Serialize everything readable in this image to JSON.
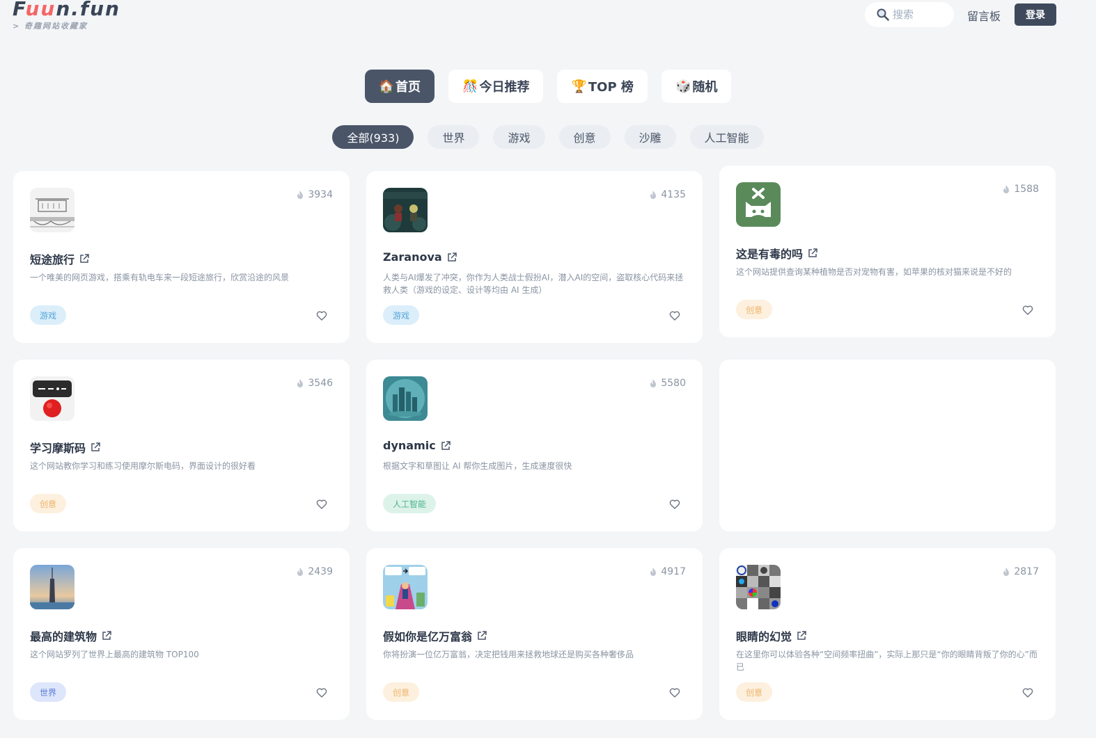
{
  "header": {
    "logo_pre": "F",
    "logo_accent": "uu",
    "logo_post": "n.fun",
    "logo_sub": "> 奇趣网站收藏家",
    "search_placeholder": "搜索",
    "message_board": "留言板",
    "login": "登录"
  },
  "nav": [
    {
      "emoji": "🏠",
      "label": "首页",
      "active": true
    },
    {
      "emoji": "🎊",
      "label": "今日推荐",
      "active": false
    },
    {
      "emoji": "🏆",
      "label": "TOP 榜",
      "active": false
    },
    {
      "emoji": "🎲",
      "label": "随机",
      "active": false
    }
  ],
  "categories": [
    {
      "label": "全部(933)",
      "active": true
    },
    {
      "label": "世界",
      "active": false
    },
    {
      "label": "游戏",
      "active": false
    },
    {
      "label": "创意",
      "active": false
    },
    {
      "label": "沙雕",
      "active": false
    },
    {
      "label": "人工智能",
      "active": false
    }
  ],
  "cards": [
    {
      "title": "短途旅行",
      "hot": "3934",
      "desc": "一个唯美的网页游戏，搭乘有轨电车来一段短途旅行，欣赏沿途的风景",
      "tag": "游戏",
      "tag_style": "game",
      "icon": "tram-sketch-icon"
    },
    {
      "title": "Zaranova",
      "hot": "4135",
      "desc": "人类与AI爆发了冲突，你作为人类战士假扮AI，潜入AI的空间，盗取核心代码来拯救人类（游戏的设定、设计等均由 AI 生成）",
      "tag": "游戏",
      "tag_style": "game",
      "icon": "zaranova-game-icon"
    },
    {
      "title": "这是有毒的吗",
      "hot": "1588",
      "desc": "这个网站提供查询某种植物是否对宠物有害，如苹果的核对猫来说是不好的",
      "tag": "创意",
      "tag_style": "creative",
      "icon": "toxic-cat-icon"
    },
    {
      "title": "学习摩斯码",
      "hot": "3546",
      "desc": "这个网站教你学习和练习使用摩尔斯电码，界面设计的很好看",
      "tag": "创意",
      "tag_style": "creative",
      "icon": "morse-key-icon"
    },
    {
      "title": "dynamic",
      "hot": "5580",
      "desc": "根据文字和草图让 AI 帮你生成图片，生成速度很快",
      "tag": "人工智能",
      "tag_style": "ai",
      "icon": "city-globe-icon"
    },
    {
      "title": "最高的建筑物",
      "hot": "2439",
      "desc": "这个网站罗列了世界上最高的建筑物 TOP100",
      "tag": "世界",
      "tag_style": "world",
      "icon": "tall-tower-icon"
    },
    {
      "title": "假如你是亿万富翁",
      "hot": "4917",
      "desc": "你将扮演一位亿万富翁，决定把钱用来拯救地球还是购买各种奢侈品",
      "tag": "创意",
      "tag_style": "creative",
      "icon": "billionaire-comic-icon"
    },
    {
      "title": "眼睛的幻觉",
      "hot": "2817",
      "desc": "在这里你可以体验各种“空间频率扭曲”，实际上那只是“你的眼睛背叛了你的心”而已",
      "tag": "创意",
      "tag_style": "creative",
      "icon": "optical-illusion-grid-icon"
    }
  ],
  "colors": {
    "background": "#f3f5f7",
    "accent": "#4a5568",
    "logo_accent": "#f56565"
  }
}
